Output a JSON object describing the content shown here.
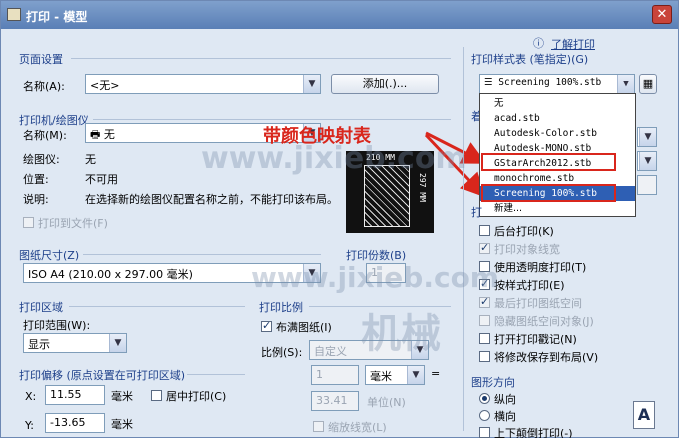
{
  "window": {
    "title": "打印 - 模型",
    "close_glyph": "✕"
  },
  "help_link": {
    "icon": "ⓘ",
    "label": "了解打印"
  },
  "page_setup": {
    "group_title": "页面设置",
    "name_label": "名称(A):",
    "name_value": "<无>",
    "add_button": "添加(.)..."
  },
  "printer": {
    "group_title": "打印机/绘图仪",
    "name_label": "名称(M):",
    "name_value": "无",
    "plotter_label": "绘图仪:",
    "plotter_value": "无",
    "location_label": "位置:",
    "location_value": "不可用",
    "desc_label": "说明:",
    "desc_value": "在选择新的绘图仪配置名称之前，不能打印该布局。",
    "print_to_file": "打印到文件(F)"
  },
  "preview": {
    "width_label": "210 MM",
    "height_label": "297 MM"
  },
  "paper_size": {
    "group_title": "图纸尺寸(Z)",
    "value": "ISO A4 (210.00 x 297.00 毫米)"
  },
  "copies": {
    "group_title": "打印份数(B)",
    "value": "1"
  },
  "plot_area": {
    "group_title": "打印区域",
    "range_label": "打印范围(W):",
    "range_value": "显示"
  },
  "plot_offset": {
    "group_title": "打印偏移 (原点设置在可打印区域)",
    "x_label": "X:",
    "x_value": "11.55",
    "x_unit": "毫米",
    "center_label": "居中打印(C)",
    "y_label": "Y:",
    "y_value": "-13.65",
    "y_unit": "毫米"
  },
  "plot_scale": {
    "group_title": "打印比例",
    "fit_label": "布满图纸(I)",
    "scale_label": "比例(S):",
    "scale_value": "自定义",
    "num_value": "1",
    "unit_value": "毫米",
    "equals": "=",
    "den_value": "33.41",
    "den_unit": "单位(N)",
    "lineweight_label": "缩放线宽(L)"
  },
  "plot_style": {
    "group_title": "打印样式表 (笔指定)(G)",
    "value": "Screening 100%.stb",
    "options": [
      "无",
      "acad.stb",
      "Autodesk-Color.stb",
      "Autodesk-MONO.stb",
      "GStarArch2012.stb",
      "monochrome.stb",
      "Screening 100%.stb",
      "新建..."
    ],
    "selected_index": 6
  },
  "shaded_group_initial": "着",
  "options": {
    "group_initial": "打",
    "items": [
      {
        "label": "后台打印(K)",
        "checked": false,
        "enabled": true
      },
      {
        "label": "打印对象线宽",
        "checked": true,
        "enabled": false
      },
      {
        "label": "使用透明度打印(T)",
        "checked": false,
        "enabled": true
      },
      {
        "label": "按样式打印(E)",
        "checked": true,
        "enabled": true
      },
      {
        "label": "最后打印图纸空间",
        "checked": true,
        "enabled": false
      },
      {
        "label": "隐藏图纸空间对象(J)",
        "checked": false,
        "enabled": false
      },
      {
        "label": "打开打印戳记(N)",
        "checked": false,
        "enabled": true
      },
      {
        "label": "将修改保存到布局(V)",
        "checked": false,
        "enabled": true
      }
    ]
  },
  "orientation": {
    "group_title": "图形方向",
    "portrait": "纵向",
    "landscape": "横向",
    "upside_down": "上下颠倒打印(-)",
    "icon_letter": "A"
  },
  "annotation": {
    "text": "带颜色映射表",
    "color": "#d9261c"
  },
  "watermarks": [
    "www.jixieb.com",
    "www.jixieb.com",
    "机械"
  ],
  "colors": {
    "accent": "#1d3f8a",
    "selection": "#2e5fb4",
    "annotation": "#d9261c"
  }
}
